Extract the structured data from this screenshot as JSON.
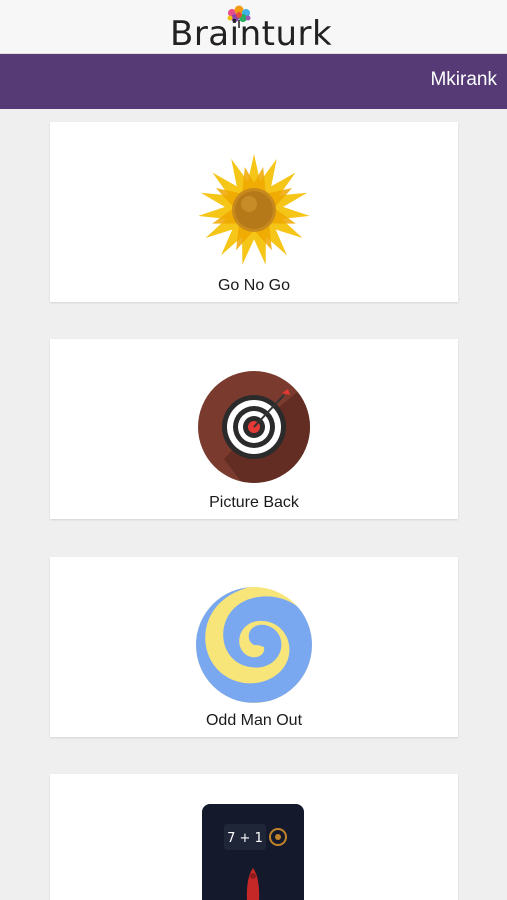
{
  "header": {
    "logo_text": "Brainturk"
  },
  "navbar": {
    "username": "Mkirank"
  },
  "games": [
    {
      "label": "Go No Go",
      "icon": "sunflower-icon"
    },
    {
      "label": "Picture Back",
      "icon": "target-icon"
    },
    {
      "label": "Odd Man Out",
      "icon": "swirl-icon"
    },
    {
      "label": "",
      "icon": "math-game-icon",
      "icon_text": "7 + 1"
    }
  ],
  "colors": {
    "navbar": "#553a75",
    "background": "#efefef",
    "card": "#ffffff"
  }
}
